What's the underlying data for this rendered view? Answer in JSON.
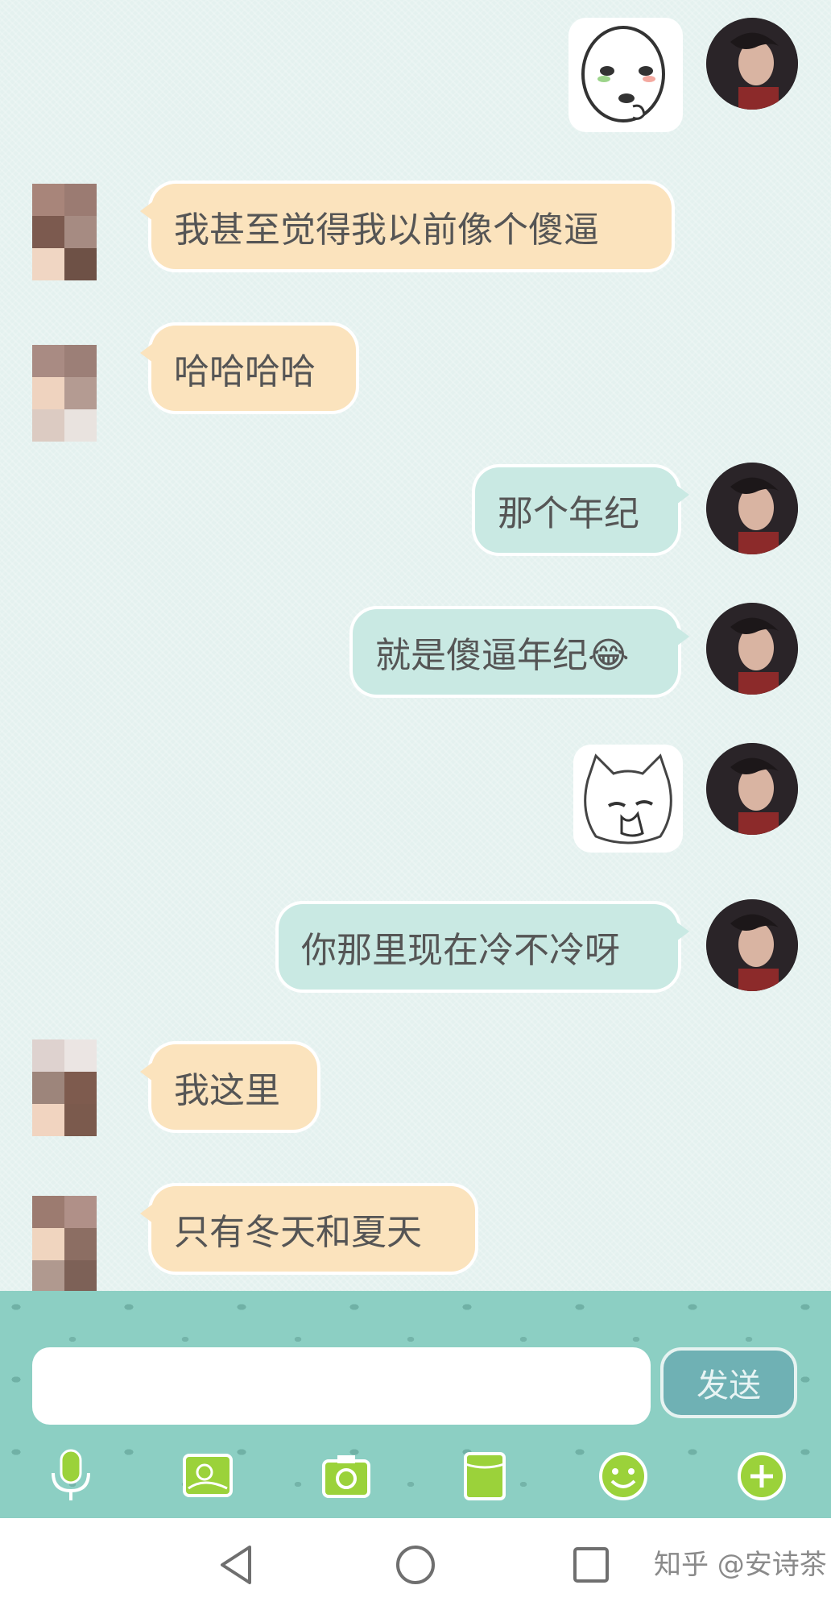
{
  "messages": [
    {
      "side": "right",
      "type": "sticker",
      "icon": "face-sticker"
    },
    {
      "side": "left",
      "type": "text",
      "text": "我甚至觉得我以前像个傻逼"
    },
    {
      "side": "left",
      "type": "text",
      "text": "哈哈哈哈"
    },
    {
      "side": "right",
      "type": "text",
      "text": "那个年纪"
    },
    {
      "side": "right",
      "type": "text",
      "text": "就是傻逼年纪😂"
    },
    {
      "side": "right",
      "type": "sticker",
      "icon": "cat-sticker"
    },
    {
      "side": "right",
      "type": "text",
      "text": "你那里现在冷不冷呀"
    },
    {
      "side": "left",
      "type": "text",
      "text": "我这里"
    },
    {
      "side": "left",
      "type": "text",
      "text": "只有冬天和夏天"
    }
  ],
  "input": {
    "value": "",
    "placeholder": ""
  },
  "send_label": "发送",
  "toolbar": [
    "microphone-icon",
    "image-icon",
    "camera-icon",
    "file-icon",
    "emoji-icon",
    "plus-icon"
  ],
  "nav": [
    "back-icon",
    "home-icon",
    "recents-icon"
  ],
  "watermark": "知乎 @安诗茶",
  "colors": {
    "left_bubble": "#fbe3bd",
    "right_bubble": "#c9e9e3",
    "input_bar": "#8ccfc3",
    "tool_icon": "#9bd23a"
  }
}
